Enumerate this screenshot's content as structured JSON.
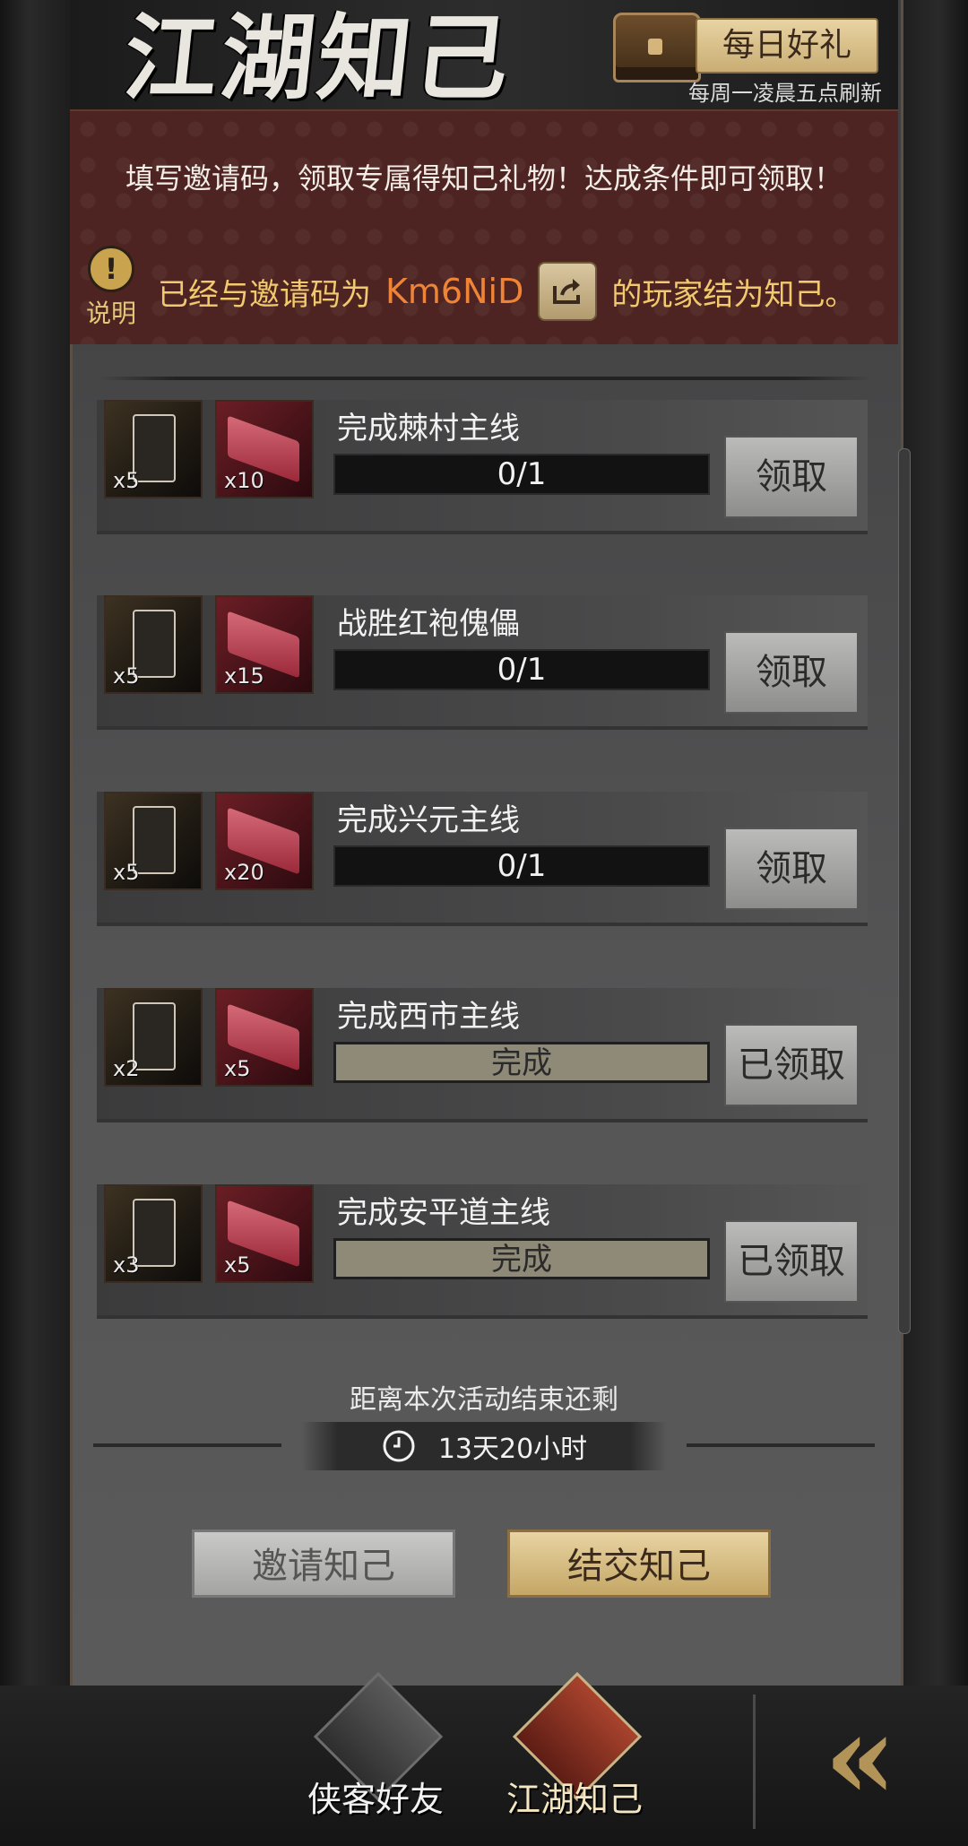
{
  "header": {
    "title": "江湖知己",
    "daily_gift_label": "每日好礼",
    "refresh_note": "每周一凌晨五点刷新"
  },
  "info": {
    "invite_desc": "填写邀请码，领取专属得知己礼物！达成条件即可领取！",
    "explain_label": "说明",
    "bound_prefix": "已经与邀请码为",
    "invite_code": "Km6NiD",
    "bound_suffix": "的玩家结为知己。"
  },
  "tasks": [
    {
      "name": "完成棘村主线",
      "plaque_qty": "x5",
      "brick_qty": "x10",
      "progress": "0/1",
      "button": "领取",
      "done": false
    },
    {
      "name": "战胜红袍傀儡",
      "plaque_qty": "x5",
      "brick_qty": "x15",
      "progress": "0/1",
      "button": "领取",
      "done": false
    },
    {
      "name": "完成兴元主线",
      "plaque_qty": "x5",
      "brick_qty": "x20",
      "progress": "0/1",
      "button": "领取",
      "done": false
    },
    {
      "name": "完成西市主线",
      "plaque_qty": "x2",
      "brick_qty": "x5",
      "progress": "完成",
      "button": "已领取",
      "done": true
    },
    {
      "name": "完成安平道主线",
      "plaque_qty": "x3",
      "brick_qty": "x5",
      "progress": "完成",
      "button": "已领取",
      "done": true
    }
  ],
  "timer": {
    "label": "距离本次活动结束还剩",
    "remaining": "13天20小时"
  },
  "actions": {
    "invite_label": "邀请知己",
    "befriend_label": "结交知己"
  },
  "bottom_nav": {
    "friends_label": "侠客好友",
    "jianghu_label": "江湖知己",
    "back_icon": "double-chevron-left-icon"
  },
  "colors": {
    "invite_code": "#f08436",
    "info_bg": "#4e2422",
    "gold": "#e8d3a2"
  }
}
